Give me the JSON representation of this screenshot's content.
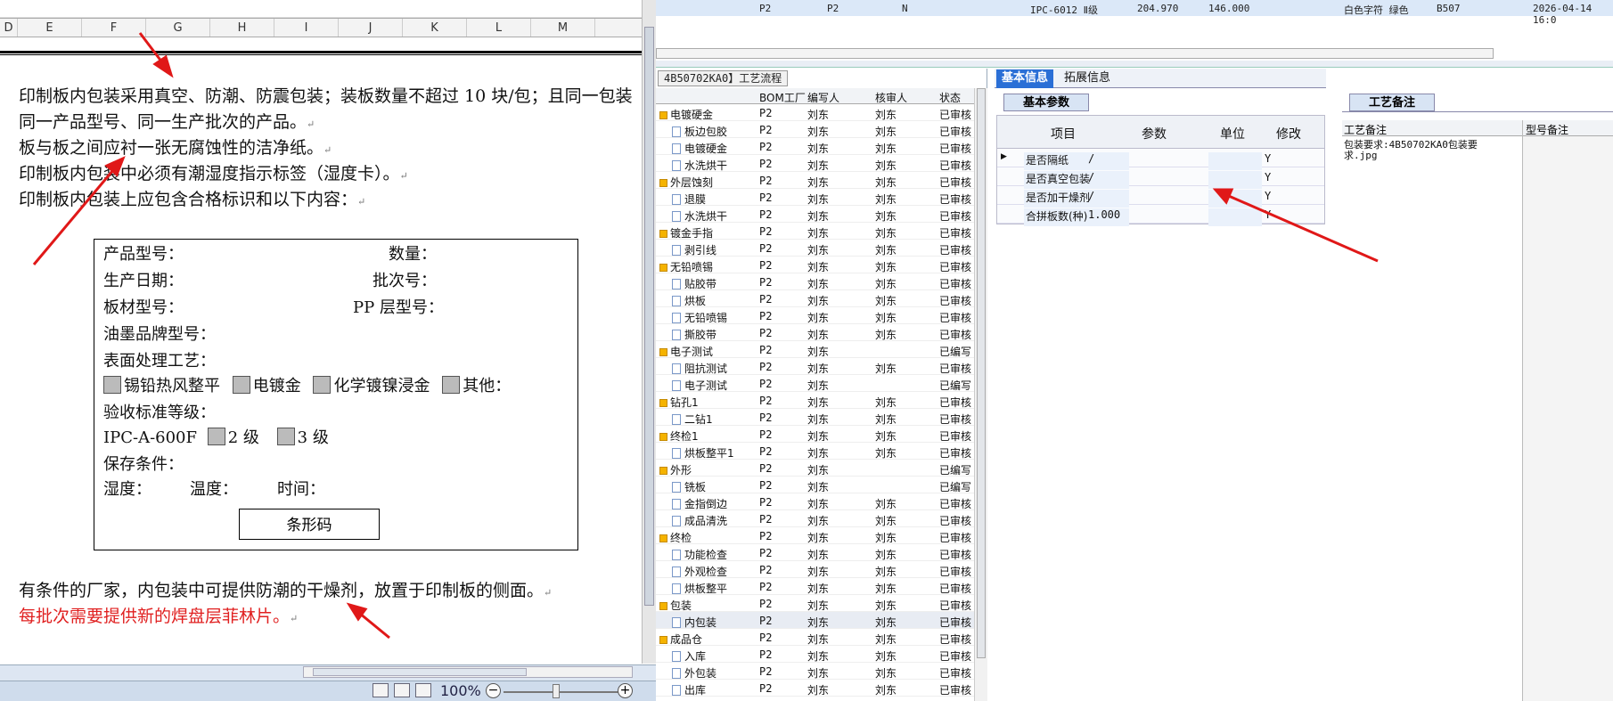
{
  "doc": {
    "columns": [
      "D",
      "E",
      "F",
      "G",
      "H",
      "I",
      "J",
      "K",
      "L",
      "M"
    ],
    "paragraphs": [
      "印制板内包装采用真空、防潮、防震包装；装板数量不超过 10 块/包；且同一包装",
      "同一产品型号、同一生产批次的产品。",
      "板与板之间应衬一张无腐蚀性的洁净纸。",
      "印制板内包装中必须有潮湿度指示标签（湿度卡）。",
      "印制板内包装上应包含合格标识和以下内容："
    ],
    "label_box": {
      "product_model": "产品型号：",
      "quantity": "数量：",
      "production_date": "生产日期：",
      "batch_no": "批次号：",
      "board_model": "板材型号：",
      "pp_model": "PP 层型号：",
      "ink_brand": "油墨品牌型号：",
      "surface_process": "表面处理工艺：",
      "opt_hasl": "锡铅热风整平",
      "opt_gold": "电镀金",
      "opt_enig": "化学镀镍浸金",
      "opt_other": "其他：",
      "accept_grade": "验收标准等级：",
      "ipc_label": "IPC-A-600F",
      "grade2": "2 级",
      "grade3": "3 级",
      "storage": "保存条件：",
      "humidity": "湿度：",
      "temperature": "温度：",
      "time": "时间：",
      "barcode": "条形码"
    },
    "para_after_box": "有条件的厂家，内包装中可提供防潮的干燥剂，放置于印制板的侧面。",
    "para_red": "每批次需要提供新的焊盘层菲林片。",
    "zoom": "100%",
    "para_mark": "↵"
  },
  "app": {
    "top_row": {
      "c1": "P2",
      "c2": "P2",
      "c3": "N",
      "c4": "IPC-6012 Ⅱ级",
      "c5": "204.970",
      "c6": "146.000",
      "c7": "白色字符  绿色",
      "c8": "B507",
      "c9": "2026-04-14 16:0"
    },
    "tree_tab": "4B50702KA0】工艺流程",
    "tree_headers": {
      "bom": "BOM工厂",
      "author": "编写人",
      "reviewer": "核审人",
      "status": "状态"
    },
    "tree_rows": [
      {
        "name": "电镀硬金",
        "type": "folder",
        "bom": "P2",
        "author": "刘东",
        "reviewer": "刘东",
        "status": "已审核"
      },
      {
        "name": "板边包胶",
        "type": "doc",
        "bom": "P2",
        "author": "刘东",
        "reviewer": "刘东",
        "status": "已审核"
      },
      {
        "name": "电镀硬金",
        "type": "doc",
        "bom": "P2",
        "author": "刘东",
        "reviewer": "刘东",
        "status": "已审核"
      },
      {
        "name": "水洗烘干",
        "type": "doc",
        "bom": "P2",
        "author": "刘东",
        "reviewer": "刘东",
        "status": "已审核"
      },
      {
        "name": "外层蚀刻",
        "type": "folder",
        "bom": "P2",
        "author": "刘东",
        "reviewer": "刘东",
        "status": "已审核"
      },
      {
        "name": "退膜",
        "type": "doc",
        "bom": "P2",
        "author": "刘东",
        "reviewer": "刘东",
        "status": "已审核"
      },
      {
        "name": "水洗烘干",
        "type": "doc",
        "bom": "P2",
        "author": "刘东",
        "reviewer": "刘东",
        "status": "已审核"
      },
      {
        "name": "镀金手指",
        "type": "folder",
        "bom": "P2",
        "author": "刘东",
        "reviewer": "刘东",
        "status": "已审核"
      },
      {
        "name": "剥引线",
        "type": "doc",
        "bom": "P2",
        "author": "刘东",
        "reviewer": "刘东",
        "status": "已审核"
      },
      {
        "name": "无铅喷锡",
        "type": "folder",
        "bom": "P2",
        "author": "刘东",
        "reviewer": "刘东",
        "status": "已审核"
      },
      {
        "name": "贴胶带",
        "type": "doc",
        "bom": "P2",
        "author": "刘东",
        "reviewer": "刘东",
        "status": "已审核"
      },
      {
        "name": "烘板",
        "type": "doc",
        "bom": "P2",
        "author": "刘东",
        "reviewer": "刘东",
        "status": "已审核"
      },
      {
        "name": "无铅喷锡",
        "type": "doc",
        "bom": "P2",
        "author": "刘东",
        "reviewer": "刘东",
        "status": "已审核"
      },
      {
        "name": "撕胶带",
        "type": "doc",
        "bom": "P2",
        "author": "刘东",
        "reviewer": "刘东",
        "status": "已审核"
      },
      {
        "name": "电子测试",
        "type": "folder",
        "bom": "P2",
        "author": "刘东",
        "reviewer": "",
        "status": "已编写"
      },
      {
        "name": "阻抗测试",
        "type": "doc",
        "bom": "P2",
        "author": "刘东",
        "reviewer": "刘东",
        "status": "已审核"
      },
      {
        "name": "电子测试",
        "type": "doc",
        "bom": "P2",
        "author": "刘东",
        "reviewer": "",
        "status": "已编写"
      },
      {
        "name": "钻孔1",
        "type": "folder",
        "bom": "P2",
        "author": "刘东",
        "reviewer": "刘东",
        "status": "已审核"
      },
      {
        "name": "二钻1",
        "type": "doc",
        "bom": "P2",
        "author": "刘东",
        "reviewer": "刘东",
        "status": "已审核"
      },
      {
        "name": "终检1",
        "type": "folder",
        "bom": "P2",
        "author": "刘东",
        "reviewer": "刘东",
        "status": "已审核"
      },
      {
        "name": "烘板整平1",
        "type": "doc",
        "bom": "P2",
        "author": "刘东",
        "reviewer": "刘东",
        "status": "已审核"
      },
      {
        "name": "外形",
        "type": "folder",
        "bom": "P2",
        "author": "刘东",
        "reviewer": "",
        "status": "已编写"
      },
      {
        "name": "铣板",
        "type": "doc",
        "bom": "P2",
        "author": "刘东",
        "reviewer": "",
        "status": "已编写"
      },
      {
        "name": "金指倒边",
        "type": "doc",
        "bom": "P2",
        "author": "刘东",
        "reviewer": "刘东",
        "status": "已审核"
      },
      {
        "name": "成品清洗",
        "type": "doc",
        "bom": "P2",
        "author": "刘东",
        "reviewer": "刘东",
        "status": "已审核"
      },
      {
        "name": "终检",
        "type": "folder",
        "bom": "P2",
        "author": "刘东",
        "reviewer": "刘东",
        "status": "已审核"
      },
      {
        "name": "功能检查",
        "type": "doc",
        "bom": "P2",
        "author": "刘东",
        "reviewer": "刘东",
        "status": "已审核"
      },
      {
        "name": "外观检查",
        "type": "doc",
        "bom": "P2",
        "author": "刘东",
        "reviewer": "刘东",
        "status": "已审核"
      },
      {
        "name": "烘板整平",
        "type": "doc",
        "bom": "P2",
        "author": "刘东",
        "reviewer": "刘东",
        "status": "已审核"
      },
      {
        "name": "包装",
        "type": "folder",
        "bom": "P2",
        "author": "刘东",
        "reviewer": "刘东",
        "status": "已审核"
      },
      {
        "name": "内包装",
        "type": "doc",
        "bom": "P2",
        "author": "刘东",
        "reviewer": "刘东",
        "status": "已审核"
      },
      {
        "name": "成品仓",
        "type": "folder",
        "bom": "P2",
        "author": "刘东",
        "reviewer": "刘东",
        "status": "已审核"
      },
      {
        "name": "入库",
        "type": "doc",
        "bom": "P2",
        "author": "刘东",
        "reviewer": "刘东",
        "status": "已审核"
      },
      {
        "name": "外包装",
        "type": "doc",
        "bom": "P2",
        "author": "刘东",
        "reviewer": "刘东",
        "status": "已审核"
      },
      {
        "name": "出库",
        "type": "doc",
        "bom": "P2",
        "author": "刘东",
        "reviewer": "刘东",
        "status": "已审核"
      }
    ],
    "selected_row": 30,
    "mid_tabs": {
      "basic": "基本信息",
      "ext": "拓展信息"
    },
    "basic_params_tab": "基本参数",
    "param_headers": {
      "item": "项目",
      "param": "参数",
      "unit": "单位",
      "edit": "修改"
    },
    "params": [
      {
        "item": "是否隔纸",
        "param": "/",
        "unit": "",
        "edit": "Y"
      },
      {
        "item": "是否真空包装",
        "param": "/",
        "unit": "",
        "edit": "Y"
      },
      {
        "item": "是否加干燥剂",
        "param": "/",
        "unit": "",
        "edit": "Y"
      },
      {
        "item": "合拼板数(种)",
        "param": "1.000",
        "unit": "",
        "edit": "Y"
      }
    ],
    "remark_tab": "工艺备注",
    "remark_headers": {
      "remark": "工艺备注",
      "model_remark": "型号备注"
    },
    "remark_text": "包装要求:4B50702KA0包装要求.jpg"
  }
}
